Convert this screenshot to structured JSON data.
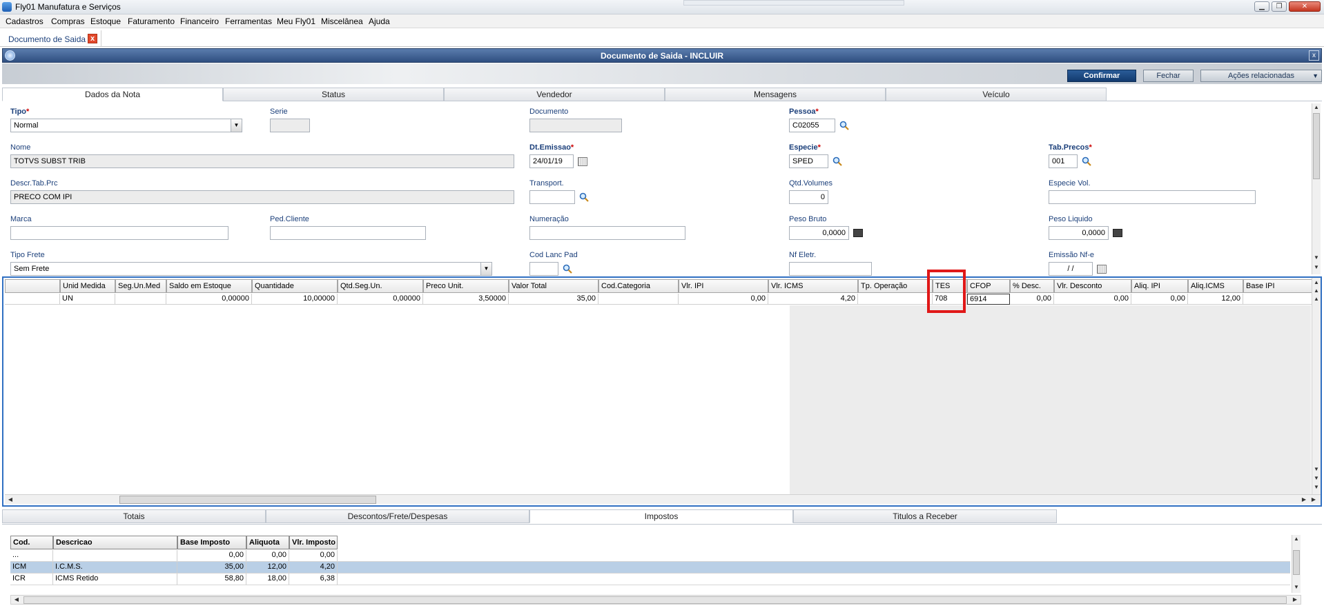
{
  "app": {
    "title": "Fly01 Manufatura e Serviços",
    "window_buttons": [
      "▁",
      "❐",
      "✕"
    ]
  },
  "menu": [
    "Cadastros",
    "Compras",
    "Estoque",
    "Faturamento",
    "Financeiro",
    "Ferramentas",
    "Meu Fly01",
    "Miscelânea",
    "Ajuda"
  ],
  "doc_tab": {
    "label": "Documento de Saida",
    "close": "x"
  },
  "window": {
    "title": "Documento de Saida - INCLUIR",
    "close": "x"
  },
  "toolbar": {
    "confirm": "Confirmar",
    "close": "Fechar",
    "related": "Ações relacionadas",
    "caret": "▼"
  },
  "main_tabs": [
    "Dados da Nota",
    "Status",
    "Vendedor",
    "Mensagens",
    "Veículo"
  ],
  "form": {
    "tipo": {
      "label": "Tipo",
      "value": "Normal"
    },
    "serie": {
      "label": "Serie",
      "value": ""
    },
    "documento": {
      "label": "Documento",
      "value": ""
    },
    "pessoa": {
      "label": "Pessoa",
      "value": "C02055"
    },
    "nome": {
      "label": "Nome",
      "value": "TOTVS SUBST TRIB"
    },
    "dt_emissao": {
      "label": "Dt.Emissao",
      "value": "24/01/19"
    },
    "especie": {
      "label": "Especie",
      "value": "SPED"
    },
    "tab_precos": {
      "label": "Tab.Precos",
      "value": "001"
    },
    "descr_tab_prc": {
      "label": "Descr.Tab.Prc",
      "value": "PRECO COM IPI"
    },
    "transport": {
      "label": "Transport.",
      "value": ""
    },
    "qtd_volumes": {
      "label": "Qtd.Volumes",
      "value": "0"
    },
    "especie_vol": {
      "label": "Especie Vol.",
      "value": ""
    },
    "marca": {
      "label": "Marca",
      "value": ""
    },
    "ped_cliente": {
      "label": "Ped.Cliente",
      "value": ""
    },
    "numeracao": {
      "label": "Numeração",
      "value": ""
    },
    "peso_bruto": {
      "label": "Peso Bruto",
      "value": "0,0000"
    },
    "peso_liquido": {
      "label": "Peso Liquido",
      "value": "0,0000"
    },
    "tipo_frete": {
      "label": "Tipo Frete",
      "value": "Sem Frete"
    },
    "cod_lanc_pad": {
      "label": "Cod Lanc Pad",
      "value": ""
    },
    "nf_eletr": {
      "label": "Nf Eletr.",
      "value": ""
    },
    "emissao_nfe": {
      "label": "Emissão Nf-e",
      "value": " /  / "
    }
  },
  "grid": {
    "columns": [
      "",
      "Unid Medida",
      "Seg.Un.Med",
      "Saldo em Estoque",
      "Quantidade",
      "Qtd.Seg.Un.",
      "Preco Unit.",
      "Valor Total",
      "Cod.Categoria",
      "Vlr. IPI",
      "Vlr. ICMS",
      "Tp. Operação",
      "TES",
      "CFOP",
      "% Desc.",
      "Vlr. Desconto",
      "Aliq. IPI",
      "Aliq.ICMS",
      "Base IPI"
    ],
    "rows": [
      [
        "",
        "UN",
        "",
        "0,00000",
        "10,00000",
        "0,00000",
        "3,50000",
        "35,00",
        "",
        "0,00",
        "4,20",
        "",
        "708",
        "6914",
        "0,00",
        "0,00",
        "0,00",
        "12,00",
        ""
      ]
    ]
  },
  "bottom_tabs": [
    "Totais",
    "Descontos/Frete/Despesas",
    "Impostos",
    "Titulos a Receber"
  ],
  "taxes": {
    "columns": [
      "Cod.",
      "Descricao",
      "Base Imposto",
      "Aliquota",
      "Vlr. Imposto"
    ],
    "rows": [
      [
        "...",
        "",
        "0,00",
        "0,00",
        "0,00"
      ],
      [
        "ICM",
        "I.C.M.S.",
        "35,00",
        "12,00",
        "4,20"
      ],
      [
        "ICR",
        "ICMS Retido",
        "58,80",
        "18,00",
        "6,38"
      ]
    ]
  },
  "colors": {
    "header_blue": "#2f4f80",
    "grid_border": "#2f6fc2",
    "highlight": "#e01818",
    "selected_row": "#b9cfe6",
    "label_blue": "#1b3f7a"
  }
}
